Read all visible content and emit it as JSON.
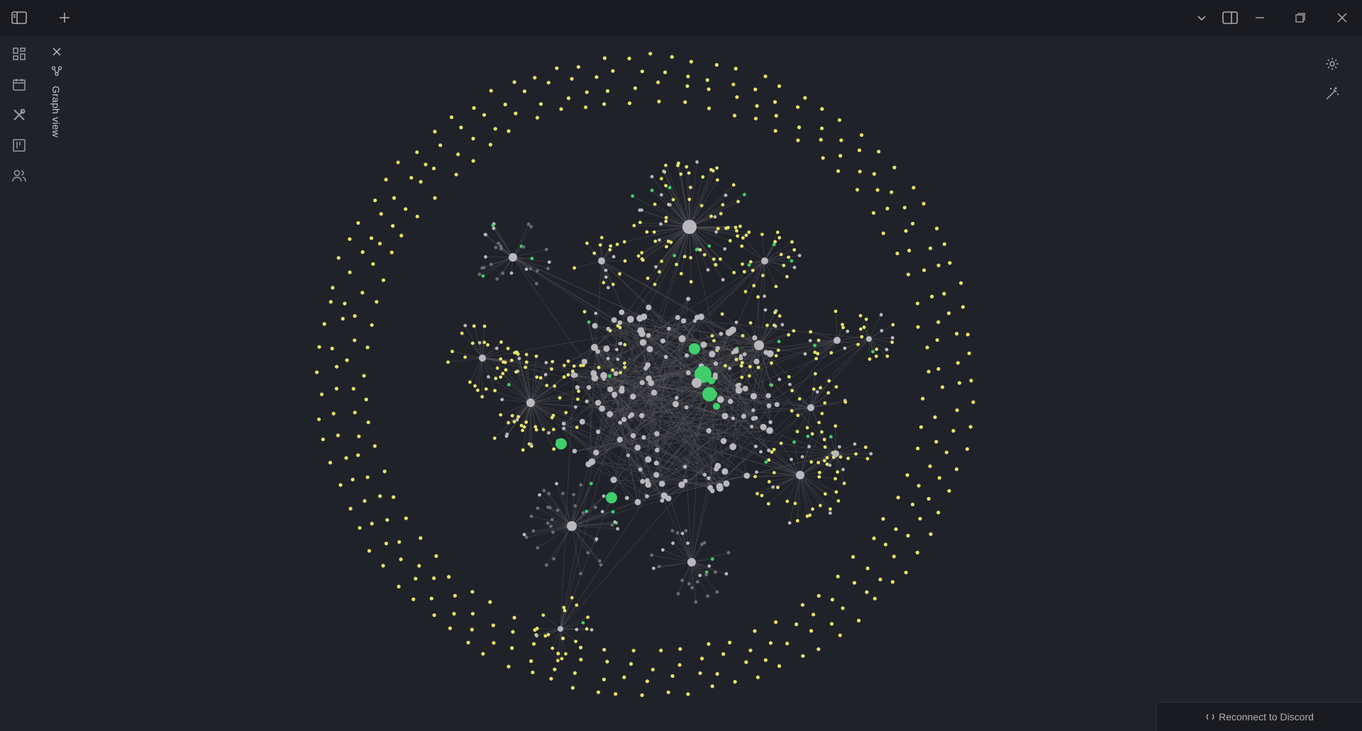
{
  "window": {
    "buttons": [
      "sidebar-toggle",
      "new-tab",
      "tab-list",
      "right-sidebar-toggle",
      "minimize",
      "restore",
      "close"
    ]
  },
  "ribbon": {
    "items": [
      {
        "name": "dashboard-icon"
      },
      {
        "name": "calendar-icon"
      },
      {
        "name": "tools-icon"
      },
      {
        "name": "kanban-icon"
      },
      {
        "name": "people-icon"
      }
    ]
  },
  "tab": {
    "label": "Graph view"
  },
  "graph": {
    "colors": {
      "node_gray": "#b9b9bd",
      "node_yellow": "#e8e46c",
      "node_green": "#3ecf6a",
      "node_dark": "#6b6b70",
      "edge": "#5a5a5f"
    }
  },
  "status": {
    "discord_label": "Reconnect to Discord"
  }
}
